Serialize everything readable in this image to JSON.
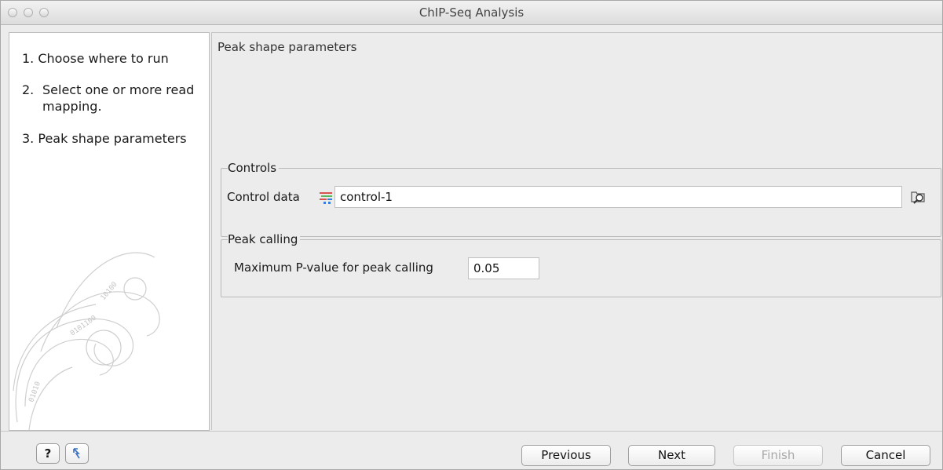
{
  "window": {
    "title": "ChIP-Seq Analysis"
  },
  "steps": [
    {
      "number": "1.",
      "label": "Choose where to run"
    },
    {
      "number": "2.",
      "label": "Select one or more read mapping."
    },
    {
      "number": "3.",
      "label": "Peak shape parameters"
    }
  ],
  "main": {
    "heading": "Peak shape parameters",
    "controls": {
      "legend": "Controls",
      "control_data_label": "Control data",
      "control_data_value": "control-1",
      "control_data_icon": "read-mapping-icon",
      "browse_icon": "browse-folder-icon"
    },
    "peak_calling": {
      "legend": "Peak calling",
      "pvalue_label": "Maximum P-value for peak calling",
      "pvalue_value": "0.05"
    }
  },
  "footer": {
    "help_label": "?",
    "reset_icon": "reset-icon",
    "previous_label": "Previous",
    "next_label": "Next",
    "finish_label": "Finish",
    "cancel_label": "Cancel"
  }
}
